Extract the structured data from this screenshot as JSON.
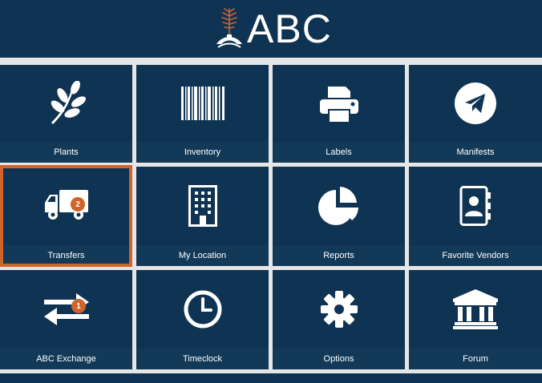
{
  "header": {
    "brand": "ABC"
  },
  "tiles": [
    {
      "label": "Plants",
      "icon": "leaf-branch-icon"
    },
    {
      "label": "Inventory",
      "icon": "barcode-icon"
    },
    {
      "label": "Labels",
      "icon": "printer-icon"
    },
    {
      "label": "Manifests",
      "icon": "paper-plane-icon"
    },
    {
      "label": "Transfers",
      "icon": "truck-icon",
      "badge": "2"
    },
    {
      "label": "My Location",
      "icon": "building-icon"
    },
    {
      "label": "Reports",
      "icon": "pie-chart-icon"
    },
    {
      "label": "Favorite Vendors",
      "icon": "contact-book-icon"
    },
    {
      "label": "ABC Exchange",
      "icon": "exchange-arrows-icon",
      "badge": "1"
    },
    {
      "label": "Timeclock",
      "icon": "clock-icon"
    },
    {
      "label": "Options",
      "icon": "gear-icon"
    },
    {
      "label": "Forum",
      "icon": "institution-icon"
    }
  ],
  "colors": {
    "tile": "#0f3352",
    "accent": "#d0632a",
    "background": "#e6e6e6"
  }
}
